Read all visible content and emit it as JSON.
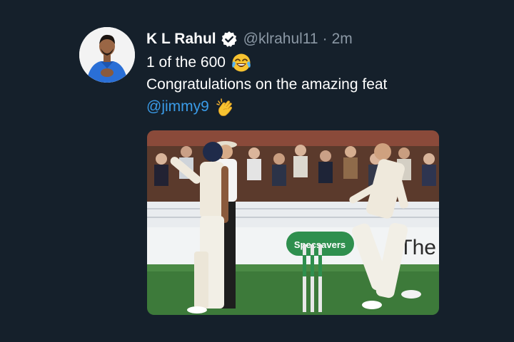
{
  "author": {
    "name": "K L Rahul",
    "handle": "@klrahul11",
    "separator": "·",
    "timestamp": "2m",
    "verified": true
  },
  "tweet": {
    "line1": "1 of the 600",
    "line1_emoji": "face-with-tears-of-joy",
    "line2": "Congratulations on the amazing feat",
    "mention": "@jimmy9",
    "mention_emoji": "clapping-hands"
  },
  "media": {
    "hoarding_text": "Specsavers",
    "hoarding_text_2": "The"
  },
  "colors": {
    "background": "#15202b",
    "mention": "#3a9be8",
    "verified_badge": "#ffffff",
    "secondary_text": "#8b98a5"
  }
}
